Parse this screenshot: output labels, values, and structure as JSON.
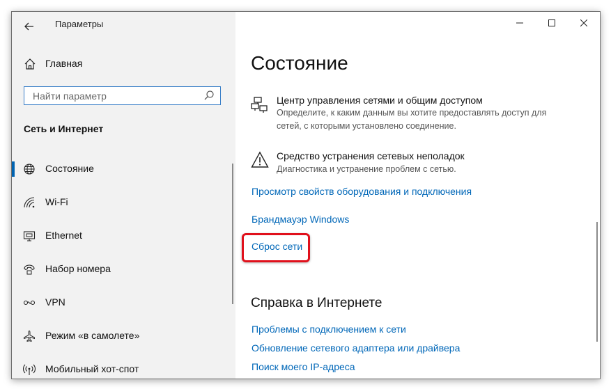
{
  "window": {
    "title": "Параметры"
  },
  "sidebar": {
    "home_label": "Главная",
    "search_placeholder": "Найти параметр",
    "section_title": "Сеть и Интернет",
    "items": [
      {
        "label": "Состояние",
        "icon": "globe-icon",
        "active": true
      },
      {
        "label": "Wi-Fi",
        "icon": "wifi-icon",
        "active": false
      },
      {
        "label": "Ethernet",
        "icon": "ethernet-icon",
        "active": false
      },
      {
        "label": "Набор номера",
        "icon": "dialup-icon",
        "active": false
      },
      {
        "label": "VPN",
        "icon": "vpn-icon",
        "active": false
      },
      {
        "label": "Режим «в самолете»",
        "icon": "airplane-icon",
        "active": false
      },
      {
        "label": "Мобильный хот-спот",
        "icon": "hotspot-icon",
        "active": false
      }
    ]
  },
  "main": {
    "title": "Состояние",
    "entries": [
      {
        "title": "Центр управления сетями и общим доступом",
        "desc": "Определите, к каким данным вы хотите предоставлять доступ для сетей, с которыми установлено соединение.",
        "icon": "network-sharing-icon"
      },
      {
        "title": "Средство устранения сетевых неполадок",
        "desc": "Диагностика и устранение проблем с сетью.",
        "icon": "warning-icon"
      }
    ],
    "links": [
      "Просмотр свойств оборудования и подключения",
      "Брандмауэр Windows",
      "Сброс сети"
    ],
    "help_title": "Справка в Интернете",
    "help_links": [
      "Проблемы с подключением к сети",
      "Обновление сетевого адаптера или драйвера",
      "Поиск моего IP-адреса"
    ]
  },
  "colors": {
    "accent": "#0063b1",
    "link": "#0067b8",
    "highlight": "#e0101b"
  }
}
